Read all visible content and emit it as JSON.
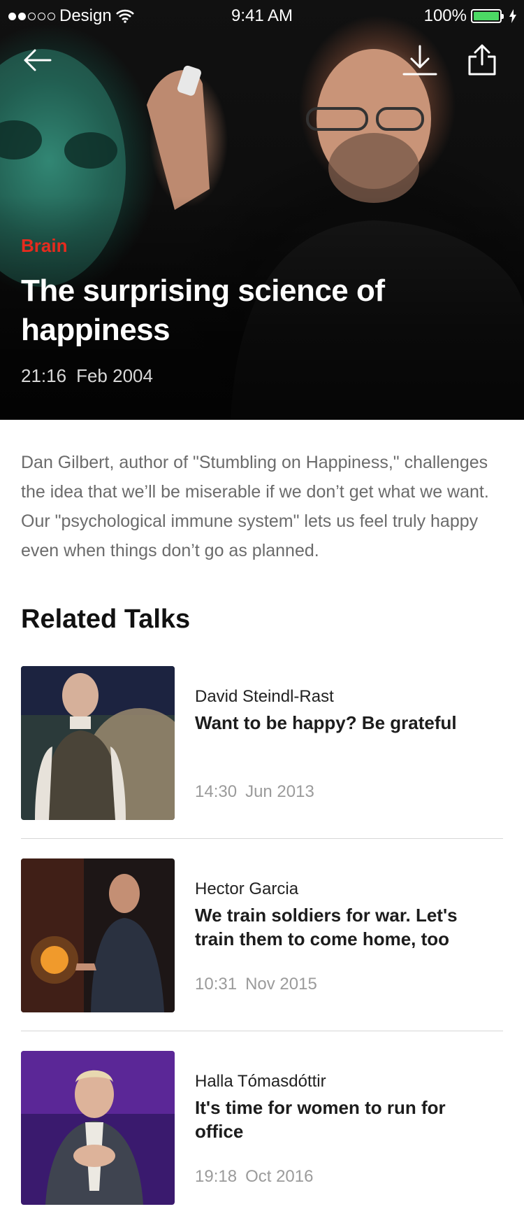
{
  "status_bar": {
    "carrier": "Design",
    "time": "9:41 AM",
    "battery": "100%"
  },
  "nav": {
    "back_icon": "arrow-left-icon",
    "download_icon": "download-icon",
    "share_icon": "share-icon"
  },
  "hero": {
    "category": "Brain",
    "title": "The surprising science of happiness",
    "duration": "21:16",
    "date": "Feb 2004"
  },
  "description": "Dan Gilbert, author of \"Stumbling on Happiness,\" challenges the idea that we’ll be miserable if we don’t get what we want. Our \"psychological immune system\" lets us feel truly happy even when things don’t go as planned.",
  "related": {
    "heading": "Related Talks",
    "items": [
      {
        "speaker": "David Steindl-Rast",
        "title": "Want to be happy? Be grateful",
        "duration": "14:30",
        "date": "Jun 2013"
      },
      {
        "speaker": "Hector Garcia",
        "title": "We train soldiers for war. Let's train them to come home, too",
        "duration": "10:31",
        "date": "Nov 2015"
      },
      {
        "speaker": "Halla Tómasdóttir",
        "title": "It's time for women to run for office",
        "duration": "19:18",
        "date": "Oct 2016"
      }
    ]
  },
  "colors": {
    "accent": "#e62b1e",
    "battery": "#4cd964",
    "muted_text": "#9b9b9b",
    "divider": "#d7d7d7"
  }
}
